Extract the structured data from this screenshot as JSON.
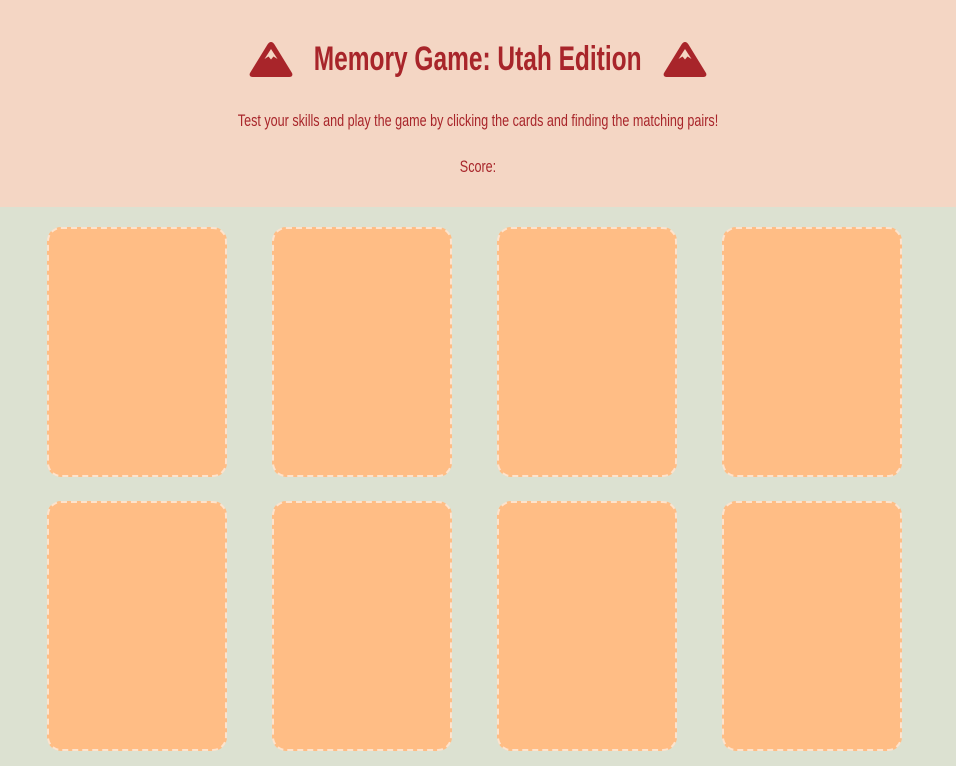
{
  "header": {
    "title": "Memory Game: Utah Edition",
    "subtitle": "Test your skills and play the game by clicking the cards and finding the matching pairs!",
    "score_label": "Score:",
    "icon": "mountain-icon"
  },
  "board": {
    "card_count": 8,
    "cards": [
      {
        "state": "face-down"
      },
      {
        "state": "face-down"
      },
      {
        "state": "face-down"
      },
      {
        "state": "face-down"
      },
      {
        "state": "face-down"
      },
      {
        "state": "face-down"
      },
      {
        "state": "face-down"
      },
      {
        "state": "face-down"
      }
    ]
  },
  "colors": {
    "header_bg": "#f4d6c4",
    "board_bg": "#dce1d1",
    "accent": "#a8252a",
    "card_back": "#ffbd85",
    "card_border": "#fde3cd"
  }
}
